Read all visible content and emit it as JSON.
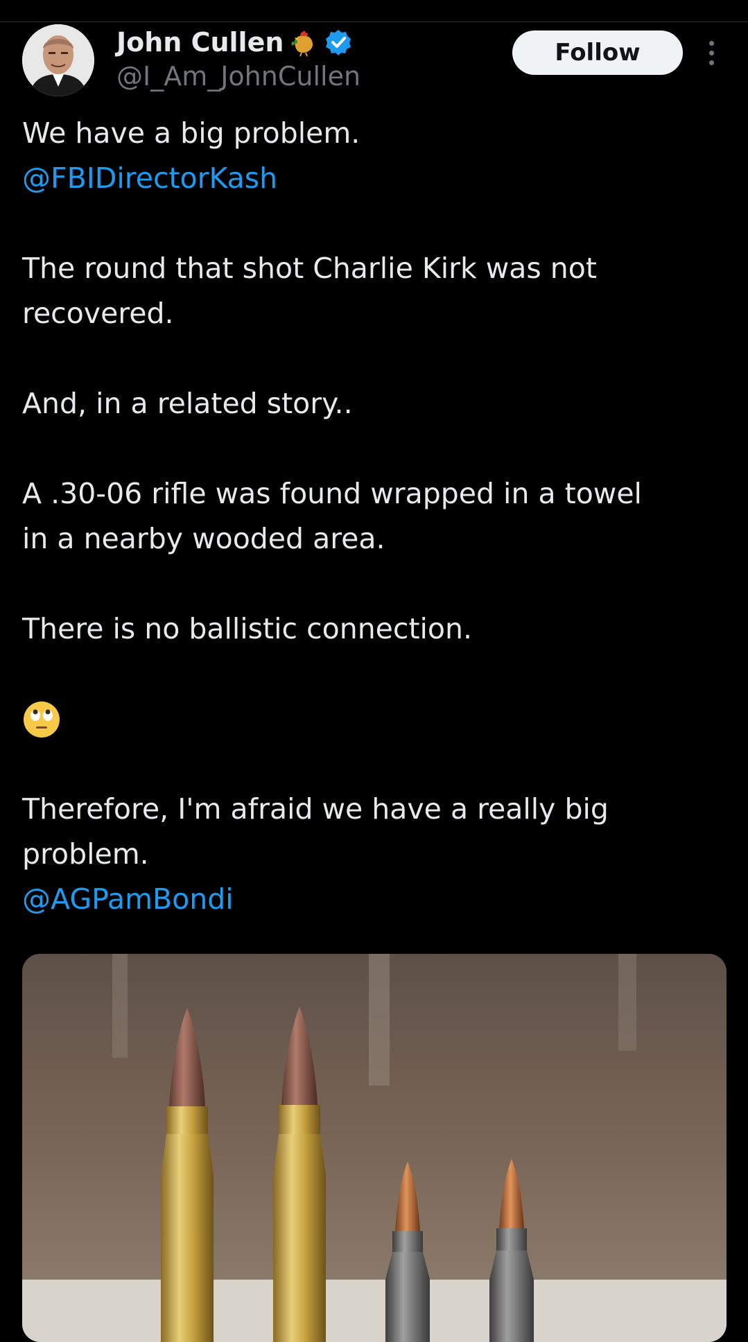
{
  "author": {
    "display_name": "John Cullen",
    "handle": "@I_Am_JohnCullen",
    "name_emoji_icon": "rooster-icon",
    "verified_icon": "verified-badge-icon"
  },
  "actions": {
    "follow_label": "Follow",
    "more_icon": "more-options-icon"
  },
  "tweet": {
    "lines": {
      "l1": "We have a big problem.",
      "l2_mention": "@FBIDirectorKash",
      "l3": "The round that shot Charlie Kirk was not",
      "l4": "recovered.",
      "l5": "And, in a related story..",
      "l6": "A .30-06 rifle was found wrapped in a towel",
      "l7": "in a nearby wooded area.",
      "l8": "There is no ballistic connection.",
      "l9_emoji": "face-with-rolling-eyes-icon",
      "l10": "Therefore, I'm afraid we have a really big",
      "l11": "problem.",
      "l12_mention": "@AGPamBondi"
    }
  },
  "media": {
    "description_icon": "rifle-cartridges-photo"
  },
  "colors": {
    "background": "#000000",
    "text": "#e7e9ea",
    "secondary_text": "#71767b",
    "link": "#1d9bf0",
    "verified": "#1d9bf0",
    "follow_bg": "#eff3f4"
  }
}
